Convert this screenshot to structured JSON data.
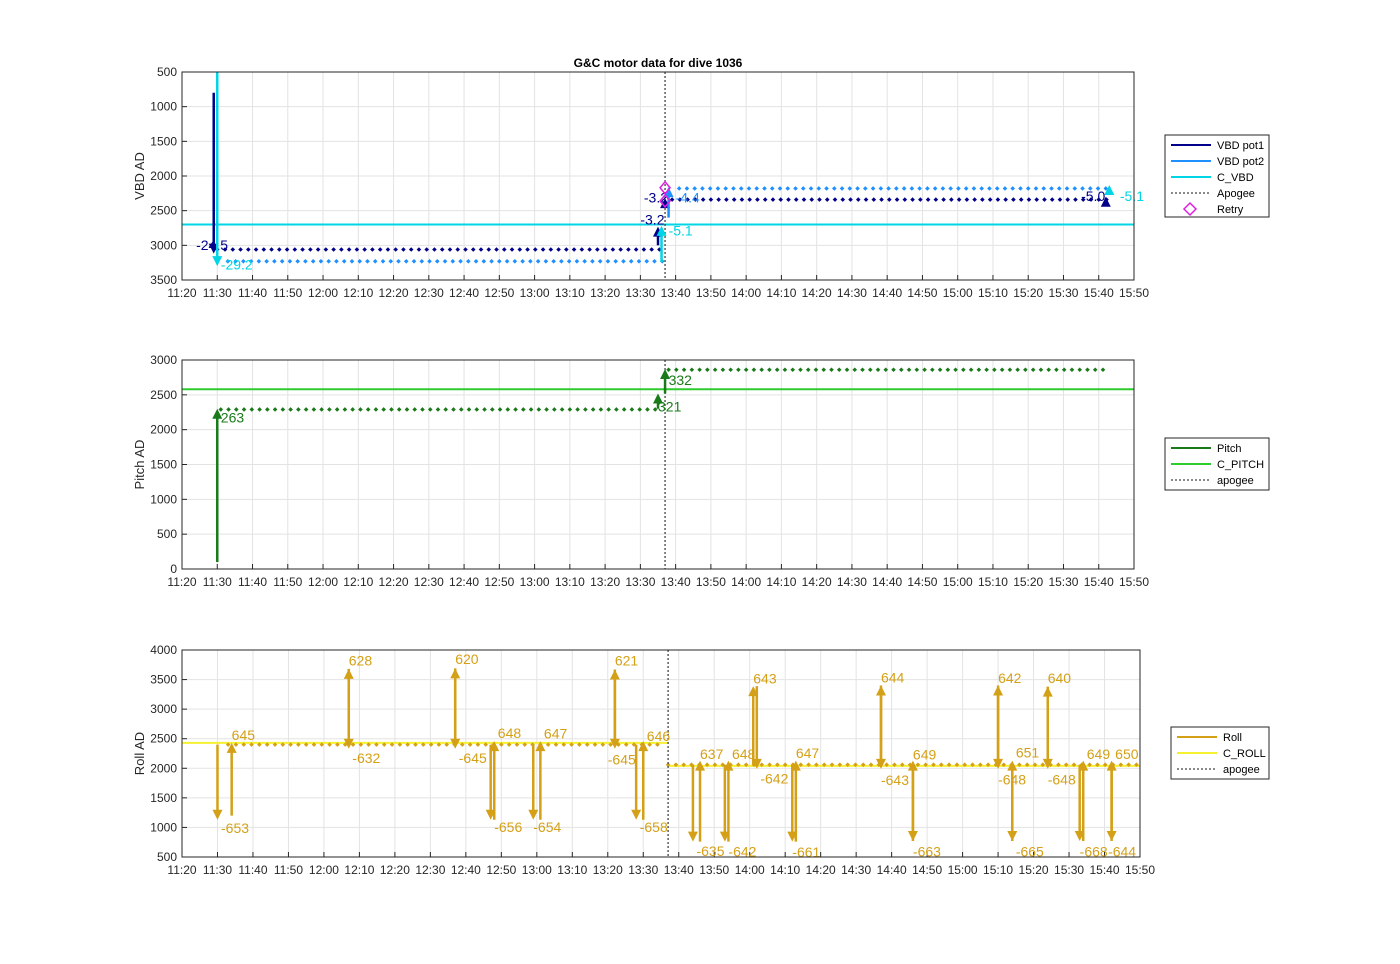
{
  "figure_title": "G&C motor data for dive 1036",
  "x_ticks": [
    "11:20",
    "11:30",
    "11:40",
    "11:50",
    "12:00",
    "12:10",
    "12:20",
    "12:30",
    "12:40",
    "12:50",
    "13:00",
    "13:10",
    "13:20",
    "13:30",
    "13:40",
    "13:50",
    "14:00",
    "14:10",
    "14:20",
    "14:30",
    "14:40",
    "14:50",
    "15:00",
    "15:10",
    "15:20",
    "15:30",
    "15:40",
    "15:50"
  ],
  "colors": {
    "vbd1": "#00008B",
    "vbd2": "#1E90FF",
    "cvbd": "#00D5E5",
    "pitch": "#1A7A1A",
    "cpitch": "#2ECC2E",
    "roll": "#D4A017",
    "croll": "#F5F030",
    "apogee": "#444444",
    "retry": "#E020E0"
  },
  "chart_data": [
    {
      "type": "line",
      "title": "G&C motor data for dive 1036",
      "ylabel": "VBD AD",
      "xlim": [
        "11:20",
        "15:50"
      ],
      "ylim": [
        3500,
        500
      ],
      "y_reversed": true,
      "y_ticks": [
        500,
        1000,
        1500,
        2000,
        2500,
        3000,
        3500
      ],
      "grid": true,
      "legend_position": "right",
      "legend": [
        "VBD pot1",
        "VBD pot2",
        "C_VBD",
        "Apogee",
        "Retry"
      ],
      "apogee_time": "13:37",
      "reference_line": {
        "name": "C_VBD",
        "value": 2700
      },
      "series": [
        {
          "name": "VBD pot1",
          "dots": {
            "start": "11:30",
            "end": "13:36",
            "value": 3060
          },
          "dots_after": {
            "start": "13:39",
            "end": "15:43",
            "value": 2340
          }
        },
        {
          "name": "VBD pot2",
          "dots": {
            "start": "11:33",
            "end": "13:37",
            "value": 3230
          },
          "dots_after": {
            "start": "13:41",
            "end": "15:43",
            "value": 2180
          }
        }
      ],
      "moves": [
        {
          "t": "11:29",
          "from": 800,
          "to": 3120,
          "color": "vbd1",
          "label": "-24.5",
          "label_x": "11:24",
          "label_y": 3070
        },
        {
          "t": "11:30",
          "from": 500,
          "to": 3300,
          "color": "cvbd",
          "label": "-29.2",
          "label_x": "11:31",
          "label_y": 3350
        },
        {
          "t": "13:35",
          "from": 3000,
          "to": 2730,
          "color": "vbd1",
          "label": "-3.2",
          "label_x": "13:30",
          "label_y": 2700
        },
        {
          "t": "13:36",
          "from": 3240,
          "to": 2720,
          "color": "cvbd",
          "label": "-5.1",
          "label_x": "13:38",
          "label_y": 2860
        },
        {
          "t": "13:37",
          "from": 2450,
          "to": 2320,
          "color": "vbd1",
          "label": "-3.2",
          "label_x": "13:31",
          "label_y": 2380
        },
        {
          "t": "13:38",
          "from": 2600,
          "to": 2160,
          "color": "vbd2",
          "label": "-4.4",
          "label_x": "13:40",
          "label_y": 2380
        },
        {
          "t": "15:42",
          "from": 2360,
          "to": 2300,
          "color": "vbd1",
          "label": "-5.0",
          "label_x": "15:35",
          "label_y": 2360
        },
        {
          "t": "15:43",
          "from": 2200,
          "to": 2130,
          "color": "cvbd",
          "label": "-5.1",
          "label_x": "15:46",
          "label_y": 2360
        }
      ],
      "retry_points": [
        {
          "t": "13:37",
          "value": 2170
        },
        {
          "t": "13:37",
          "value": 2360
        }
      ]
    },
    {
      "type": "line",
      "ylabel": "Pitch AD",
      "xlim": [
        "11:20",
        "15:50"
      ],
      "ylim": [
        0,
        3000
      ],
      "y_ticks": [
        0,
        500,
        1000,
        1500,
        2000,
        2500,
        3000
      ],
      "grid": true,
      "legend_position": "right",
      "legend": [
        "Pitch",
        "C_PITCH",
        "apogee"
      ],
      "apogee_time": "13:37",
      "reference_line": {
        "name": "C_PITCH",
        "value": 2580
      },
      "series": [
        {
          "name": "Pitch",
          "dots": {
            "start": "11:31",
            "end": "13:35",
            "value": 2290
          },
          "dots_after": {
            "start": "13:38",
            "end": "15:43",
            "value": 2860
          }
        }
      ],
      "moves": [
        {
          "t": "11:30",
          "from": 100,
          "to": 2300,
          "color": "pitch",
          "label": "263",
          "label_x": "11:31",
          "label_y": 2100
        },
        {
          "t": "13:35",
          "from": 2300,
          "to": 2520,
          "color": "pitch",
          "label": "321",
          "label_x": "13:35",
          "label_y": 2260
        },
        {
          "t": "13:37",
          "from": 2520,
          "to": 2870,
          "color": "pitch",
          "label": "332",
          "label_x": "13:38",
          "label_y": 2640
        }
      ]
    },
    {
      "type": "line",
      "ylabel": "Roll AD",
      "xlim": [
        "11:20",
        "15:50"
      ],
      "ylim": [
        500,
        4000
      ],
      "y_ticks": [
        500,
        1000,
        1500,
        2000,
        2500,
        3000,
        3500,
        4000
      ],
      "grid": true,
      "legend_position": "right",
      "legend": [
        "Roll",
        "C_ROLL",
        "apogee"
      ],
      "apogee_time": "13:37",
      "reference_lines": [
        {
          "name": "C_ROLL",
          "value": 2430,
          "start": "11:20",
          "end": "13:37"
        },
        {
          "name": "C_ROLL",
          "value": 2040,
          "start": "13:37",
          "end": "15:50"
        }
      ],
      "series": [
        {
          "name": "Roll",
          "dots": {
            "start": "11:33",
            "end": "13:35",
            "value": 2400
          },
          "dots_after": {
            "start": "13:37",
            "end": "15:50",
            "value": 2060
          }
        }
      ],
      "moves": [
        {
          "t": "11:30",
          "from": 2400,
          "to": 1130,
          "color": "roll",
          "label": "-653",
          "label_x": "11:31",
          "label_y": 910
        },
        {
          "t": "11:34",
          "from": 1200,
          "to": 2430,
          "color": "roll",
          "label": "645",
          "label_x": "11:34",
          "label_y": 2480
        },
        {
          "t": "12:07",
          "from": 2400,
          "to": 3680,
          "color": "roll",
          "label": "628",
          "label_x": "12:07",
          "label_y": 3740
        },
        {
          "t": "12:07",
          "from": 3680,
          "to": 2330,
          "color": "roll",
          "label": "-632",
          "label_x": "12:08",
          "label_y": 2090
        },
        {
          "t": "12:37",
          "from": 2400,
          "to": 3690,
          "color": "roll",
          "label": "620",
          "label_x": "12:37",
          "label_y": 3760
        },
        {
          "t": "12:37",
          "from": 3690,
          "to": 2330,
          "color": "roll",
          "label": "-645",
          "label_x": "12:38",
          "label_y": 2090
        },
        {
          "t": "12:47",
          "from": 2400,
          "to": 1130,
          "color": "roll",
          "label": "-656",
          "label_x": "12:48",
          "label_y": 920
        },
        {
          "t": "12:48",
          "from": 1130,
          "to": 2460,
          "color": "roll",
          "label": "648",
          "label_x": "12:49",
          "label_y": 2510
        },
        {
          "t": "12:59",
          "from": 2400,
          "to": 1130,
          "color": "roll",
          "label": "-654",
          "label_x": "12:59",
          "label_y": 920
        },
        {
          "t": "13:01",
          "from": 1130,
          "to": 2460,
          "color": "roll",
          "label": "647",
          "label_x": "13:02",
          "label_y": 2500
        },
        {
          "t": "13:22",
          "from": 2400,
          "to": 3670,
          "color": "roll",
          "label": "621",
          "label_x": "13:22",
          "label_y": 3740
        },
        {
          "t": "13:22",
          "from": 3670,
          "to": 2330,
          "color": "roll",
          "label": "-645",
          "label_x": "13:20",
          "label_y": 2060
        },
        {
          "t": "13:28",
          "from": 2400,
          "to": 1130,
          "color": "roll",
          "label": "-658",
          "label_x": "13:29",
          "label_y": 920
        },
        {
          "t": "13:30",
          "from": 1130,
          "to": 2460,
          "color": "roll",
          "label": "646",
          "label_x": "13:31",
          "label_y": 2460
        },
        {
          "t": "13:44",
          "from": 2060,
          "to": 760,
          "color": "roll",
          "label": "-635",
          "label_x": "13:45",
          "label_y": 520
        },
        {
          "t": "13:46",
          "from": 760,
          "to": 2130,
          "color": "roll",
          "label": "637",
          "label_x": "13:46",
          "label_y": 2160
        },
        {
          "t": "13:53",
          "from": 2060,
          "to": 760,
          "color": "roll",
          "label": "-642",
          "label_x": "13:54",
          "label_y": 510
        },
        {
          "t": "13:54",
          "from": 760,
          "to": 2130,
          "color": "roll",
          "label": "648",
          "label_x": "13:55",
          "label_y": 2160
        },
        {
          "t": "14:01",
          "from": 2060,
          "to": 3390,
          "color": "roll",
          "label": "643",
          "label_x": "14:01",
          "label_y": 3430
        },
        {
          "t": "14:02",
          "from": 3390,
          "to": 1990,
          "color": "roll",
          "label": "-642",
          "label_x": "14:03",
          "label_y": 1740
        },
        {
          "t": "14:12",
          "from": 2060,
          "to": 760,
          "color": "roll",
          "label": "-661",
          "label_x": "14:12",
          "label_y": 500
        },
        {
          "t": "14:13",
          "from": 760,
          "to": 2130,
          "color": "roll",
          "label": "647",
          "label_x": "14:13",
          "label_y": 2170
        },
        {
          "t": "14:37",
          "from": 2060,
          "to": 3400,
          "color": "roll",
          "label": "644",
          "label_x": "14:37",
          "label_y": 3450
        },
        {
          "t": "14:37",
          "from": 3400,
          "to": 1990,
          "color": "roll",
          "label": "-643",
          "label_x": "14:37",
          "label_y": 1720
        },
        {
          "t": "14:46",
          "from": 2060,
          "to": 770,
          "color": "roll",
          "label": "-663",
          "label_x": "14:46",
          "label_y": 510
        },
        {
          "t": "14:46",
          "from": 770,
          "to": 2130,
          "color": "roll",
          "label": "649",
          "label_x": "14:46",
          "label_y": 2150
        },
        {
          "t": "15:10",
          "from": 2060,
          "to": 3400,
          "color": "roll",
          "label": "642",
          "label_x": "15:10",
          "label_y": 3440
        },
        {
          "t": "15:10",
          "from": 3400,
          "to": 1990,
          "color": "roll",
          "label": "-648",
          "label_x": "15:10",
          "label_y": 1730
        },
        {
          "t": "15:14",
          "from": 2060,
          "to": 770,
          "color": "roll",
          "label": "-665",
          "label_x": "15:15",
          "label_y": 510
        },
        {
          "t": "15:14",
          "from": 770,
          "to": 2130,
          "color": "roll",
          "label": "651",
          "label_x": "15:15",
          "label_y": 2180
        },
        {
          "t": "15:24",
          "from": 2060,
          "to": 3380,
          "color": "roll",
          "label": "640",
          "label_x": "15:24",
          "label_y": 3440
        },
        {
          "t": "15:24",
          "from": 3380,
          "to": 1990,
          "color": "roll",
          "label": "-648",
          "label_x": "15:24",
          "label_y": 1730
        },
        {
          "t": "15:33",
          "from": 2060,
          "to": 770,
          "color": "roll",
          "label": "-668",
          "label_x": "15:33",
          "label_y": 510
        },
        {
          "t": "15:34",
          "from": 770,
          "to": 2130,
          "color": "roll",
          "label": "649",
          "label_x": "15:35",
          "label_y": 2160
        },
        {
          "t": "15:42",
          "from": 2060,
          "to": 770,
          "color": "roll",
          "label": "-644",
          "label_x": "15:41",
          "label_y": 510
        },
        {
          "t": "15:42",
          "from": 770,
          "to": 2130,
          "color": "roll",
          "label": "650",
          "label_x": "15:43",
          "label_y": 2160
        }
      ]
    }
  ]
}
